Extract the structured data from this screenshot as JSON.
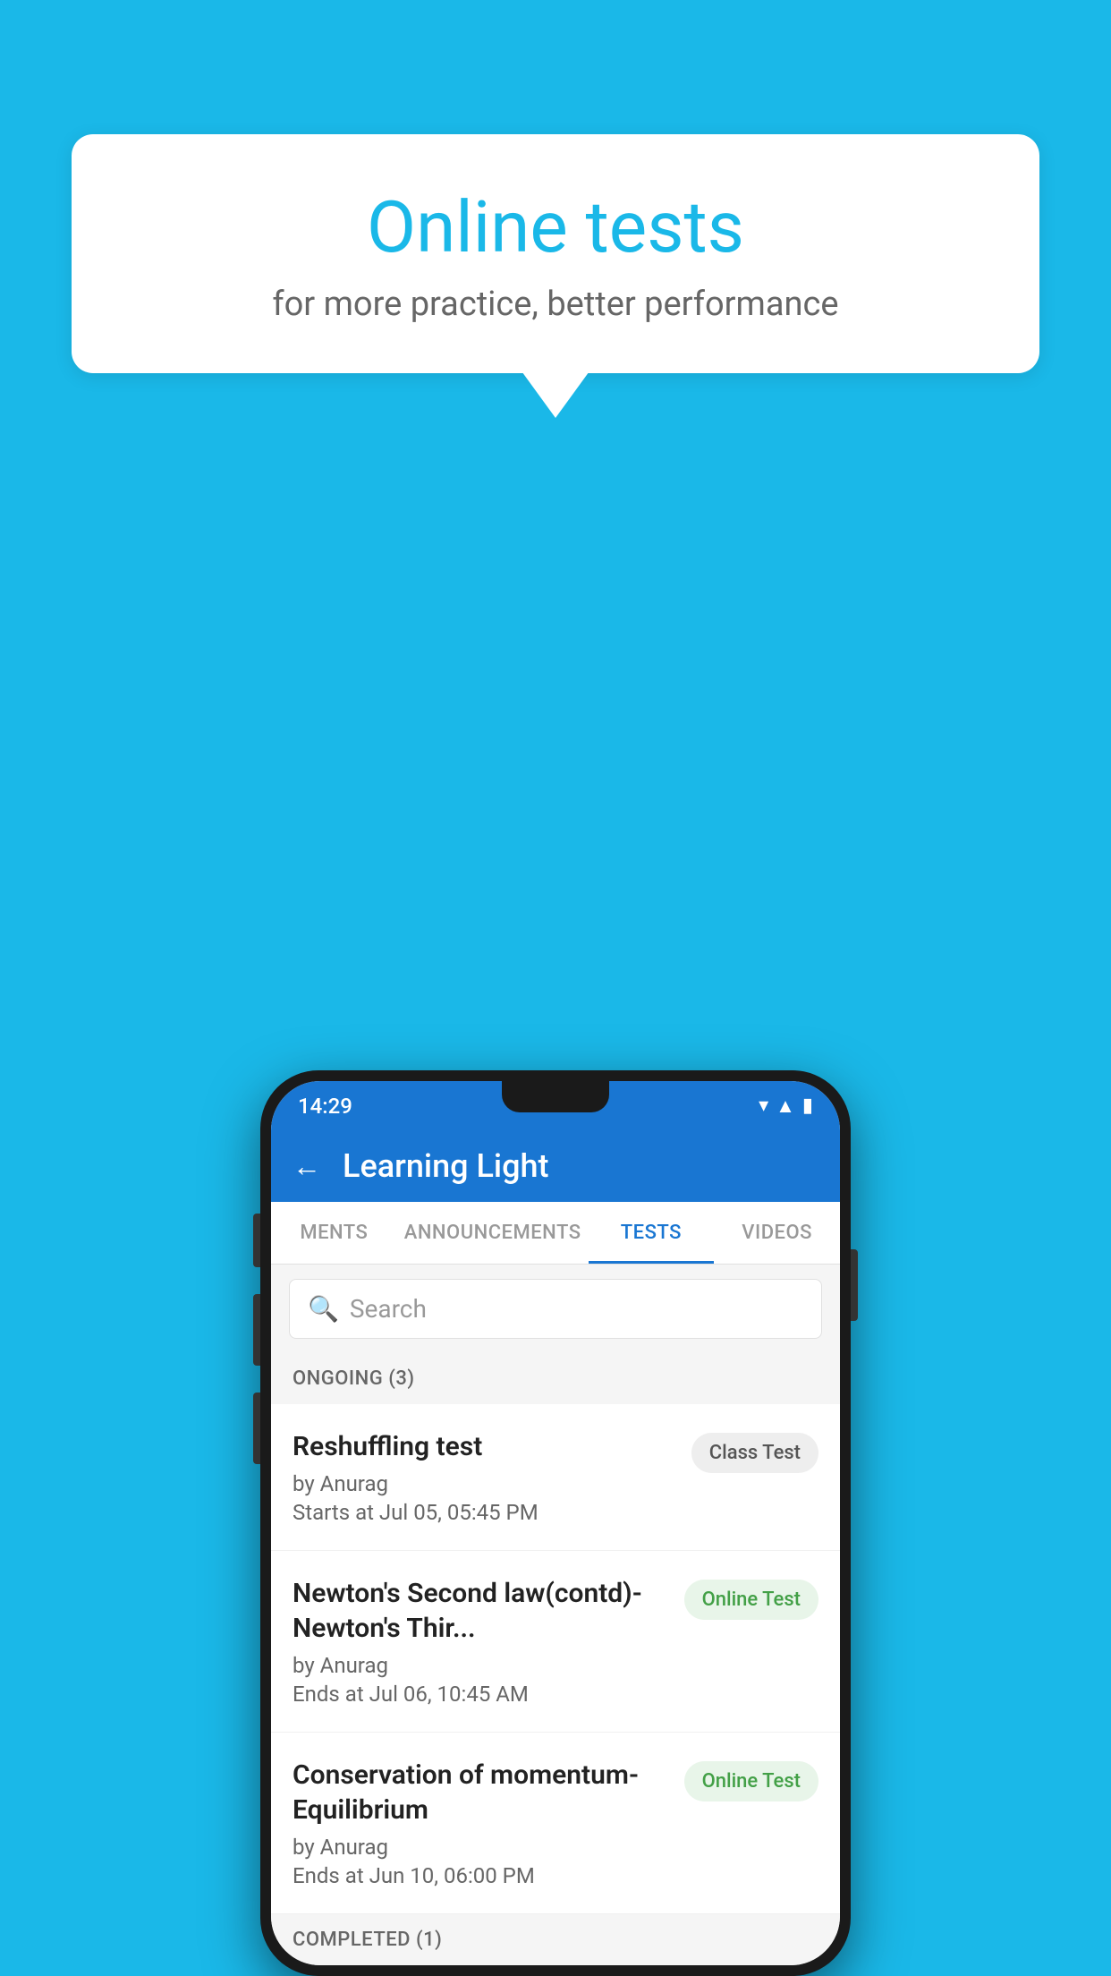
{
  "background": {
    "color": "#1ab8e8"
  },
  "bubble": {
    "title": "Online tests",
    "subtitle": "for more practice, better performance"
  },
  "status_bar": {
    "time": "14:29",
    "icons": "▼◀▮"
  },
  "app_bar": {
    "title": "Learning Light",
    "back_icon": "←"
  },
  "tabs": [
    {
      "label": "MENTS",
      "active": false
    },
    {
      "label": "ANNOUNCEMENTS",
      "active": false
    },
    {
      "label": "TESTS",
      "active": true
    },
    {
      "label": "VIDEOS",
      "active": false
    }
  ],
  "search": {
    "placeholder": "Search",
    "icon": "🔍"
  },
  "ongoing": {
    "header": "ONGOING (3)",
    "items": [
      {
        "name": "Reshuffling test",
        "by": "by Anurag",
        "time": "Starts at  Jul 05, 05:45 PM",
        "badge": "Class Test",
        "badge_type": "class"
      },
      {
        "name": "Newton's Second law(contd)-Newton's Thir...",
        "by": "by Anurag",
        "time": "Ends at  Jul 06, 10:45 AM",
        "badge": "Online Test",
        "badge_type": "online"
      },
      {
        "name": "Conservation of momentum-Equilibrium",
        "by": "by Anurag",
        "time": "Ends at  Jun 10, 06:00 PM",
        "badge": "Online Test",
        "badge_type": "online"
      }
    ]
  },
  "completed": {
    "header": "COMPLETED (1)"
  }
}
